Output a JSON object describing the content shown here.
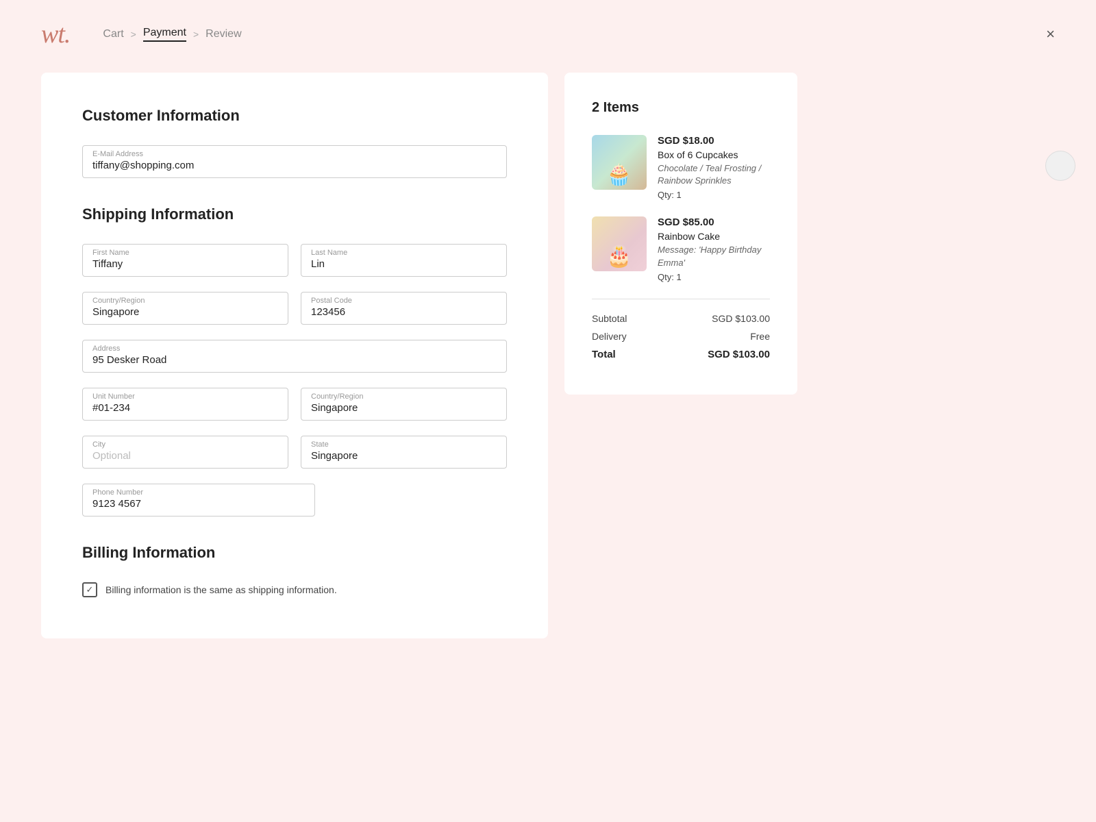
{
  "header": {
    "logo": "wt.",
    "breadcrumb": {
      "cart": "Cart",
      "sep1": ">",
      "payment": "Payment",
      "sep2": ">",
      "review": "Review"
    },
    "close_label": "×"
  },
  "customer_info": {
    "title": "Customer Information",
    "email_label": "E-Mail Address",
    "email_value": "tiffany@shopping.com"
  },
  "shipping_info": {
    "title": "Shipping Information",
    "first_name_label": "First Name",
    "first_name_value": "Tiffany",
    "last_name_label": "Last Name",
    "last_name_value": "Lin",
    "country_label": "Country/Region",
    "country_value": "Singapore",
    "postal_label": "Postal Code",
    "postal_value": "123456",
    "address_label": "Address",
    "address_value": "95 Desker Road",
    "unit_label": "Unit Number",
    "unit_value": "#01-234",
    "country2_label": "Country/Region",
    "country2_value": "Singapore",
    "city_label": "City",
    "city_placeholder": "Optional",
    "state_label": "State",
    "state_value": "Singapore",
    "phone_label": "Phone Number",
    "phone_value": "9123 4567"
  },
  "billing_info": {
    "title": "Billing Information",
    "same_as_shipping_label": "Billing information is the same as shipping information."
  },
  "order_summary": {
    "title": "2 Items",
    "items": [
      {
        "price": "SGD $18.00",
        "name": "Box of 6 Cupcakes",
        "variant": "Chocolate / Teal Frosting / Rainbow Sprinkles",
        "qty": "Qty: 1",
        "image_type": "cupcake"
      },
      {
        "price": "SGD $85.00",
        "name": "Rainbow Cake",
        "variant": "Message: 'Happy Birthday Emma'",
        "qty": "Qty: 1",
        "image_type": "cake"
      }
    ],
    "subtotal_label": "Subtotal",
    "subtotal_value": "SGD $103.00",
    "delivery_label": "Delivery",
    "delivery_value": "Free",
    "total_label": "Total",
    "total_value": "SGD $103.00"
  }
}
